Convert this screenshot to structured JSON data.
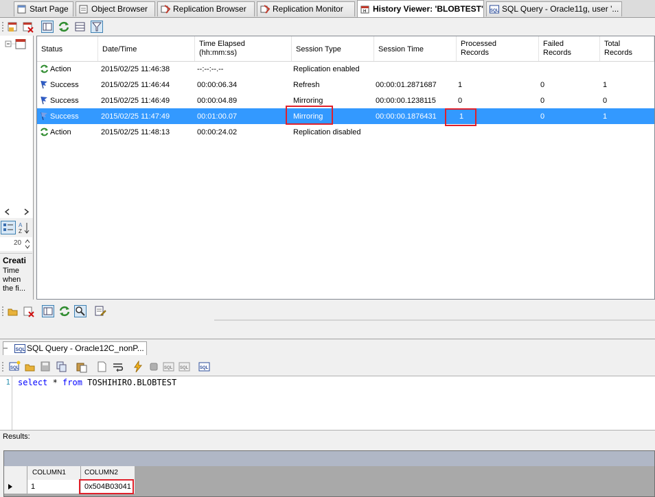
{
  "tabs": [
    {
      "label": "Start Page",
      "icon": "start-page-icon"
    },
    {
      "label": "Object Browser",
      "icon": "object-browser-icon"
    },
    {
      "label": "Replication Browser",
      "icon": "replication-browser-icon"
    },
    {
      "label": "Replication Monitor",
      "icon": "replication-monitor-icon"
    },
    {
      "label": "History Viewer: 'BLOBTEST'",
      "icon": "history-icon",
      "active": true
    },
    {
      "label": "SQL Query - Oracle11g, user '...",
      "icon": "sql-icon"
    }
  ],
  "history": {
    "columns": [
      "Status",
      "Date/Time",
      "Time Elapsed\n(hh:mm:ss)",
      "Session Type",
      "Session Time",
      "Processed\nRecords",
      "Failed\nRecords",
      "Total\nRecords"
    ],
    "rows": [
      {
        "status": "Action",
        "datetime": "2015/02/25 11:46:38",
        "elapsed": "--:--:--.--",
        "session_type": "Replication enabled",
        "session_time": "",
        "processed": "",
        "failed": "",
        "total": "",
        "icon": "action-icon"
      },
      {
        "status": "Success",
        "datetime": "2015/02/25 11:46:44",
        "elapsed": "00:00:06.34",
        "session_type": "Refresh",
        "session_time": "00:00:01.2871687",
        "processed": "1",
        "failed": "0",
        "total": "1",
        "icon": "success-flag-icon"
      },
      {
        "status": "Success",
        "datetime": "2015/02/25 11:46:49",
        "elapsed": "00:00:04.89",
        "session_type": "Mirroring",
        "session_time": "00:00:00.1238115",
        "processed": "0",
        "failed": "0",
        "total": "0",
        "icon": "success-flag-icon"
      },
      {
        "status": "Success",
        "datetime": "2015/02/25 11:47:49",
        "elapsed": "00:01:00.07",
        "session_type": "Mirroring",
        "session_time": "00:00:00.1876431",
        "processed": "1",
        "failed": "0",
        "total": "1",
        "icon": "success-flag-icon",
        "selected": true
      },
      {
        "status": "Action",
        "datetime": "2015/02/25 11:48:13",
        "elapsed": "00:00:24.02",
        "session_type": "Replication disabled",
        "session_time": "",
        "processed": "",
        "failed": "",
        "total": "",
        "icon": "action-icon"
      }
    ]
  },
  "left_panel": {
    "zoom_value": "20",
    "desc_title": "Creati",
    "desc_text": "Time when the fi..."
  },
  "sql_panel": {
    "tab_label": "SQL Query - Oracle12C_nonP...",
    "line_number": "1",
    "code_kw1": "select",
    "code_star": " * ",
    "code_kw2": "from",
    "code_rest": " TOSHIHIRO.BLOBTEST",
    "results_label": "Results:",
    "result_columns": [
      "COLUMN1",
      "COLUMN2"
    ],
    "result_row": [
      "1",
      "0x504B03041"
    ]
  },
  "colors": {
    "selection": "#3399ff",
    "highlight_box": "#e0202a",
    "keyword": "#0000ff"
  }
}
